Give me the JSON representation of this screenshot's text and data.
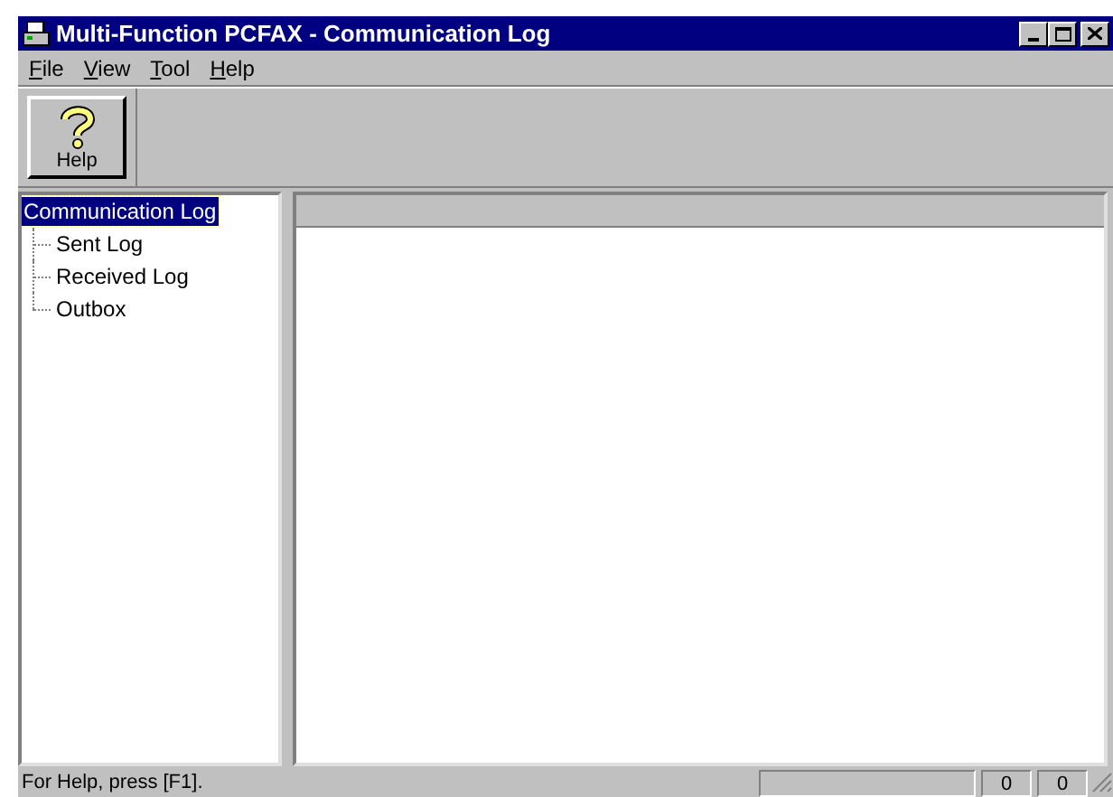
{
  "window": {
    "title": "Multi-Function PCFAX - Communication Log"
  },
  "menu": [
    "File",
    "View",
    "Tool",
    "Help"
  ],
  "toolbar": [
    {
      "label": "Help"
    }
  ],
  "tree": [
    {
      "label": "Communication Log",
      "selected": true,
      "children": [
        {
          "label": "Sent Log",
          "selected": false
        },
        {
          "label": "Received Log",
          "selected": false
        },
        {
          "label": "Outbox",
          "selected": false
        }
      ]
    }
  ],
  "status_bar": {
    "message": "For Help, press [F1].",
    "panels": [
      "0",
      "0"
    ]
  }
}
